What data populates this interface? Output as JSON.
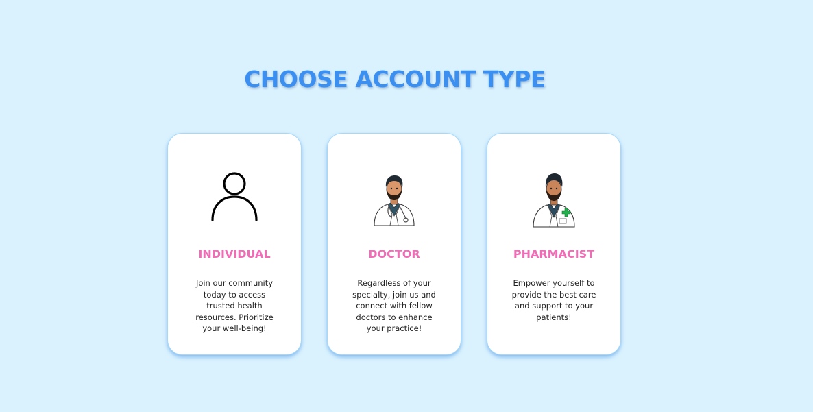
{
  "page": {
    "title": "CHOOSE ACCOUNT TYPE"
  },
  "cards": [
    {
      "label": "INDIVIDUAL",
      "description": "Join our community today to access trusted health resources. Prioritize your well-being!",
      "icon": "person-outline-icon"
    },
    {
      "label": "DOCTOR",
      "description": "Regardless of your specialty, join us and connect with fellow doctors to enhance your practice!",
      "icon": "doctor-avatar-icon"
    },
    {
      "label": "PHARMACIST",
      "description": "Empower yourself to provide the best care and support to your patients!",
      "icon": "pharmacist-avatar-icon"
    }
  ],
  "colors": {
    "background": "#daf2fe",
    "title": "#3b8ff0",
    "label": "#f06db6",
    "card": "#ffffff",
    "cross": "#22b14c"
  }
}
